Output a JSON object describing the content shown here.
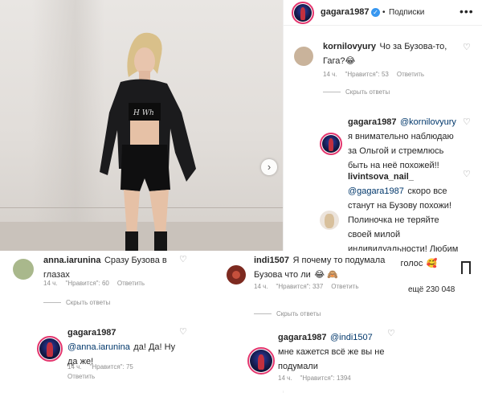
{
  "header": {
    "username": "gagara1987",
    "follow_dot": "•",
    "follow_label": "Подписки",
    "more_label": "•••"
  },
  "comments": [
    {
      "username": "kornilovyury",
      "text": "Чо за Бузова-то, Гага?",
      "emoji": "😂",
      "time": "14 ч.",
      "likes": "\"Нравится\": 53",
      "reply": "Ответить",
      "hide_replies": "Скрыть ответы"
    },
    {
      "username": "gagara1987",
      "mention": "@kornilovyury",
      "text": "я внимательно наблюдаю за Ольгой и стремлюсь быть на неё похожей!!"
    },
    {
      "username": "livintsova_nail_",
      "mention": "@gagara1987",
      "text": "скоро все станут на Бузову похожи! Полиночка не теряйте своей милой индивидуальности! Любим ваш образ и голос",
      "emoji": "🥰"
    }
  ],
  "overlay_left": {
    "comment": {
      "username": "anna.iarunina",
      "text": "Сразу Бузова в глазах",
      "time": "14 ч.",
      "likes": "\"Нравится\": 60",
      "reply": "Ответить",
      "hide_replies": "Скрыть ответы"
    },
    "reply": {
      "username": "gagara1987",
      "mention": "@anna.iarunina",
      "text": "да! Да! Ну да же!",
      "time": "14 ч.",
      "likes": "\"Нравится\": 75",
      "reply": "Ответить"
    }
  },
  "overlay_right": {
    "comment": {
      "username": "indi1507",
      "text": "Я почему то подумала Бузова что ли",
      "emoji": "😂 🙈",
      "time": "14 ч.",
      "likes": "\"Нравится\": 337",
      "reply": "Ответить",
      "hide_replies": "Скрыть ответы"
    },
    "reply": {
      "username": "gagara1987",
      "mention": "@indi1507",
      "text": "мне кажется всё же вы не подумали",
      "time": "14 ч.",
      "likes": "\"Нравится\": 1394"
    }
  },
  "photo": {
    "shirt_text": "H Wh"
  },
  "likes_more": "ещё 230 048",
  "heart_glyph": "♡",
  "next_glyph": "›",
  "colors": {
    "verified": "#3897f0",
    "story_ring": "#e3356d",
    "muted": "#8e8e8e"
  }
}
